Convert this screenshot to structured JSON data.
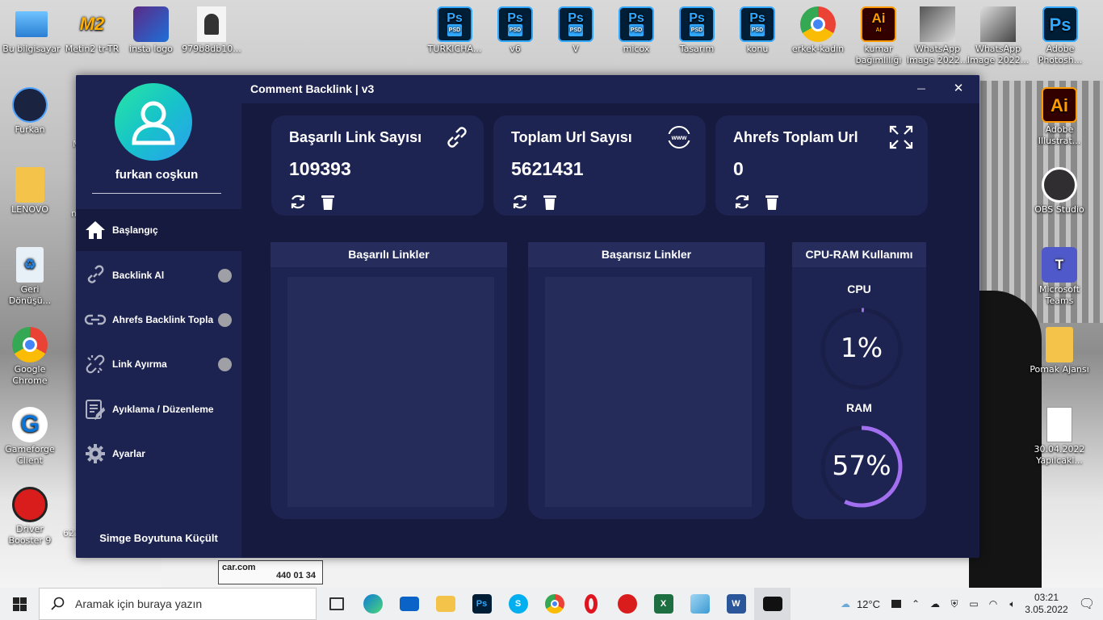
{
  "desktop": {
    "icons_top": [
      {
        "label": "Bu bilgisayar",
        "icon": "computer-icon"
      },
      {
        "label": "Metin2 tr-TR",
        "icon": "metin2-icon"
      },
      {
        "label": "insta logo",
        "icon": "image-icon"
      },
      {
        "label": "979b8db10...",
        "icon": "image-icon"
      },
      {
        "label": "TURKICHA...",
        "icon": "psd-icon"
      },
      {
        "label": "v6",
        "icon": "psd-icon"
      },
      {
        "label": "V",
        "icon": "psd-icon"
      },
      {
        "label": "micox",
        "icon": "psd-icon"
      },
      {
        "label": "Tasarım",
        "icon": "psd-icon"
      },
      {
        "label": "konu",
        "icon": "psd-icon"
      },
      {
        "label": "erkek-kadın",
        "icon": "chrome-icon"
      },
      {
        "label": "kumar bağımlılığı",
        "icon": "ai-icon"
      },
      {
        "label": "WhatsApp Image 2022...",
        "icon": "image-icon"
      },
      {
        "label": "WhatsApp Image 2022...",
        "icon": "image-icon"
      },
      {
        "label": "Adobe Photosh...",
        "icon": "photoshop-icon"
      }
    ],
    "icons_left": [
      {
        "label": "Furkan",
        "icon": "camera-icon"
      },
      {
        "label": "LENOVO",
        "icon": "folder-user-icon"
      },
      {
        "label": "Geri Dönüşü...",
        "icon": "recycle-bin-icon"
      },
      {
        "label": "Google Chrome",
        "icon": "chrome-icon"
      },
      {
        "label": "Gameforge Client",
        "icon": "gameforge-icon"
      },
      {
        "label": "Driver Booster 9",
        "icon": "driver-booster-icon"
      }
    ],
    "icons_right": [
      {
        "label": "Adobe Illustrat...",
        "icon": "illustrator-icon"
      },
      {
        "label": "OBS Studio",
        "icon": "obs-icon"
      },
      {
        "label": "Microsoft Teams",
        "icon": "teams-icon"
      },
      {
        "label": "Pomak Ajansı",
        "icon": "folder-icon"
      },
      {
        "label": "30.04.2022 Yapılcakl...",
        "icon": "document-icon"
      }
    ],
    "partial_labels": [
      "M",
      "n",
      "623"
    ],
    "photo_text": {
      "plate": "440 01 34",
      "brand": "car.com"
    }
  },
  "app": {
    "title": "Comment Backlink | v3",
    "minimize_symbol": "—",
    "close_symbol": "✕",
    "user": {
      "name": "furkan coşkun"
    },
    "nav": [
      {
        "label": "Başlangıç",
        "icon": "home-icon",
        "active": true
      },
      {
        "label": "Backlink Al",
        "icon": "link-icon",
        "status_dot": true
      },
      {
        "label": "Ahrefs Backlink Topla",
        "icon": "chain-link-icon",
        "status_dot": true
      },
      {
        "label": "Link Ayırma",
        "icon": "broken-link-icon",
        "status_dot": true
      },
      {
        "label": "Ayıklama / Düzenleme",
        "icon": "list-edit-icon"
      },
      {
        "label": "Ayarlar",
        "icon": "gear-icon"
      }
    ],
    "minimize_label": "Simge Boyutuna Küçült",
    "stats": [
      {
        "title": "Başarılı Link Sayısı",
        "value": "109393",
        "icon": "link-icon"
      },
      {
        "title": "Toplam Url Sayısı",
        "value": "5621431",
        "icon": "www-icon"
      },
      {
        "title": "Ahrefs Toplam Url",
        "value": "0",
        "icon": "expand-icon"
      }
    ],
    "panels": {
      "success_title": "Başarılı Linkler",
      "fail_title": "Başarısız Linkler",
      "usage_title": "CPU-RAM Kullanımı"
    },
    "usage": {
      "cpu_label": "CPU",
      "cpu_value": "1%",
      "cpu_percent": 1,
      "ram_label": "RAM",
      "ram_value": "57%",
      "ram_percent": 57,
      "gauge_color": "#a26ff0",
      "track_color": "#1a1f47"
    },
    "colors": {
      "sidebar": "#1d2350",
      "content": "#151a3e",
      "card": "#1e2451"
    }
  },
  "taskbar": {
    "search_placeholder": "Aramak için buraya yazın",
    "apps": [
      "task-view-icon",
      "edge-icon",
      "mail-icon",
      "file-explorer-icon",
      "photoshop-icon",
      "skype-icon",
      "chrome-icon",
      "opera-icon",
      "driver-booster-icon",
      "excel-icon",
      "notepad-icon",
      "word-icon",
      "app-icon"
    ],
    "weather": "12°C",
    "time": "03:21",
    "date": "3.05.2022"
  }
}
